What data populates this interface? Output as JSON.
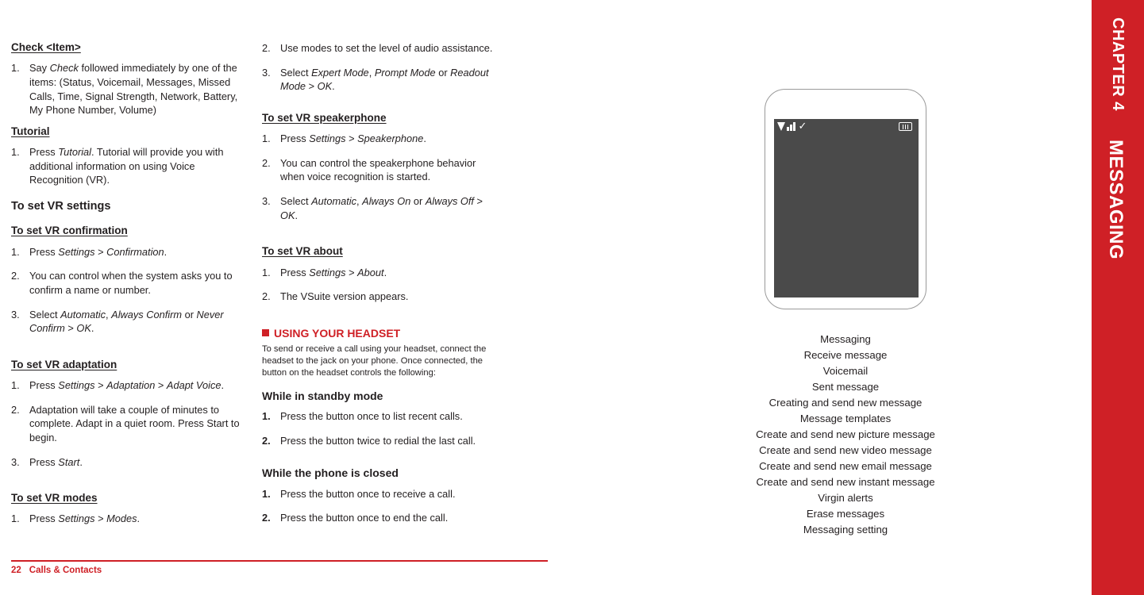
{
  "sidebar": {
    "chapter_label": "CHAPTER 4",
    "chapter_title": "MESSAGING"
  },
  "footer": {
    "page_number": "22",
    "section": "Calls & Contacts"
  },
  "column1": {
    "check_item": {
      "heading": "Check <Item>",
      "steps": [
        {
          "num": "1.",
          "text": "Say Check followed immediately by one of the items: (Status, Voicemail, Messages, Missed Calls, Time, Signal Strength, Network, Battery, My Phone Number, Volume)"
        }
      ]
    },
    "tutorial": {
      "heading": "Tutorial",
      "steps": [
        {
          "num": "1.",
          "text": "Press Tutorial. Tutorial will provide you with additional information on using Voice Recognition (VR)."
        }
      ]
    },
    "vr_settings_heading": "To set VR settings",
    "vr_confirmation": {
      "heading": "To set VR confirmation",
      "steps": [
        {
          "num": "1.",
          "text": "Press Settings > Confirmation."
        },
        {
          "num": "2.",
          "text": "You can control when the system asks you to confirm a name or number."
        },
        {
          "num": "3.",
          "text": "Select Automatic, Always Confirm or Never Confirm > OK."
        }
      ]
    },
    "vr_adaptation": {
      "heading": "To set VR adaptation",
      "steps": [
        {
          "num": "1.",
          "text": "Press Settings > Adaptation > Adapt Voice."
        },
        {
          "num": "2.",
          "text": "Adaptation will take a couple of minutes to complete. Adapt in a quiet room. Press Start to begin."
        },
        {
          "num": "3.",
          "text": "Press Start."
        }
      ]
    },
    "vr_modes": {
      "heading": "To set VR modes",
      "steps": [
        {
          "num": "1.",
          "text": "Press Settings > Modes."
        }
      ]
    }
  },
  "column2": {
    "modes_continued": [
      {
        "num": "2.",
        "text": "Use modes to set the level of audio assistance."
      },
      {
        "num": "3.",
        "text": "Select Expert Mode, Prompt Mode or Readout Mode > OK."
      }
    ],
    "vr_speakerphone": {
      "heading": "To set VR speakerphone",
      "steps": [
        {
          "num": "1.",
          "text": "Press Settings > Speakerphone."
        },
        {
          "num": "2.",
          "text": "You can control the speakerphone behavior when voice recognition is started."
        },
        {
          "num": "3.",
          "text": "Select Automatic, Always On or Always Off > OK."
        }
      ]
    },
    "vr_about": {
      "heading": "To set VR about",
      "steps": [
        {
          "num": "1.",
          "text": "Press Settings > About."
        },
        {
          "num": "2.",
          "text": "The VSuite version appears."
        }
      ]
    },
    "headset": {
      "heading": "USING YOUR HEADSET",
      "intro": "To send or receive a call using your headset, connect the headset to the jack on your phone. Once connected, the button on the headset controls the following:",
      "standby_heading": "While in standby mode",
      "standby_steps": [
        {
          "num": "1.",
          "text": "Press the button once to list recent calls."
        },
        {
          "num": "2.",
          "text": "Press the button twice to redial the last call."
        }
      ],
      "closed_heading": "While the phone is closed",
      "closed_steps": [
        {
          "num": "1.",
          "text": "Press the button once to receive a call."
        },
        {
          "num": "2.",
          "text": "Press the button once to end the call."
        }
      ]
    }
  },
  "phone": {
    "chapter_label": "CHAPTER 4",
    "chapter_title": "MESSAGING"
  },
  "toc": {
    "items": [
      "Messaging",
      "Receive message",
      "Voicemail",
      "Sent message",
      "Creating and send new message",
      "Message templates",
      "Create and send new picture message",
      "Create and send new video message",
      "Create and send new email message",
      "Create and send new instant message",
      "Virgin alerts",
      "Erase messages",
      "Messaging setting"
    ]
  },
  "colors": {
    "accent": "#cf2026",
    "text": "#231f20",
    "screen": "#4a4a4a"
  }
}
